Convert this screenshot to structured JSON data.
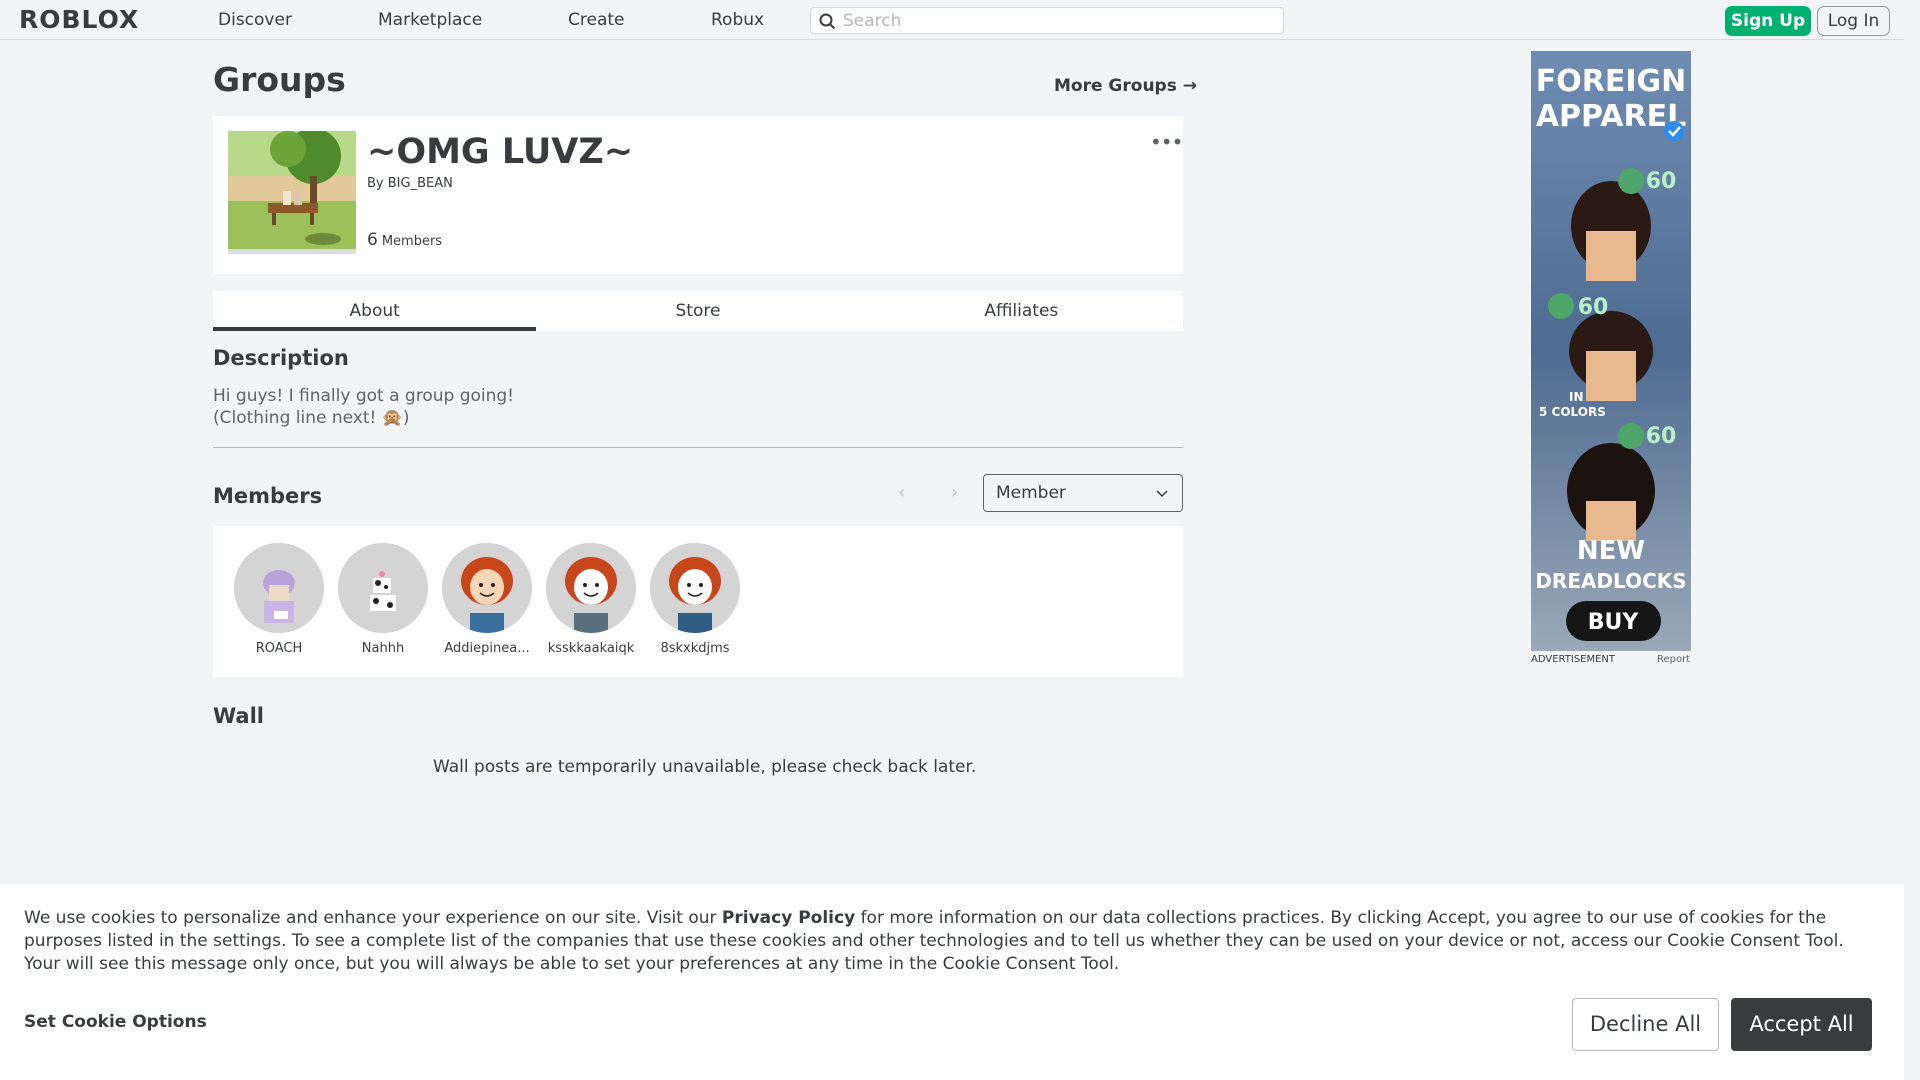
{
  "nav": {
    "logo": "ROBLOX",
    "links": [
      "Discover",
      "Marketplace",
      "Create",
      "Robux"
    ],
    "search_placeholder": "Search",
    "signup_label": "Sign Up",
    "login_label": "Log In"
  },
  "header": {
    "title": "Groups",
    "more_groups": "More Groups →"
  },
  "group": {
    "name": "~OMG LUVZ~",
    "by_prefix": "By",
    "owner": "BIG_BEAN",
    "member_count": "6",
    "member_label": "Members",
    "menu_icon": "more-dots-icon"
  },
  "tabs": [
    "About",
    "Store",
    "Affiliates"
  ],
  "description": {
    "heading": "Description",
    "text": "Hi guys! I finally got a group going!\n(Clothing line next! 🙊)"
  },
  "members": {
    "heading": "Members",
    "role_select": "Member",
    "list": [
      {
        "name": "ROACH"
      },
      {
        "name": "Nahhh"
      },
      {
        "name": "Addiepinea..."
      },
      {
        "name": "ksskkaakaiqk"
      },
      {
        "name": "8skxkdjms"
      }
    ]
  },
  "wall": {
    "heading": "Wall",
    "message": "Wall posts are temporarily unavailable, please check back later."
  },
  "ad": {
    "label": "ADVERTISEMENT",
    "report": "Report",
    "brand_line1": "FOREIGN",
    "brand_line2": "APPAREL",
    "price1": "60",
    "price2": "60",
    "price3": "60",
    "tag1": "IN",
    "tag2": "5 COLORS",
    "headline1": "NEW",
    "headline2": "DREADLOCKS",
    "cta": "BUY"
  },
  "cookie": {
    "text_before": "We use cookies to personalize and enhance your experience on our site. Visit our ",
    "privacy_link": "Privacy Policy",
    "text_after": " for more information on our data collections practices. By clicking Accept, you agree to our use of cookies for the purposes listed in the settings. To see a complete list of the companies that use these cookies and other technologies and to tell us whether they can be used on your device or not, access our Cookie Consent Tool. Your will see this message only once, but you will always be able to set your preferences at any time in the Cookie Consent Tool.",
    "set_options": "Set Cookie Options",
    "decline": "Decline All",
    "accept": "Accept All"
  },
  "colors": {
    "signup_green": "#00b06f",
    "accept_dark": "#393b3d",
    "page_bg": "#f2f4f5"
  }
}
